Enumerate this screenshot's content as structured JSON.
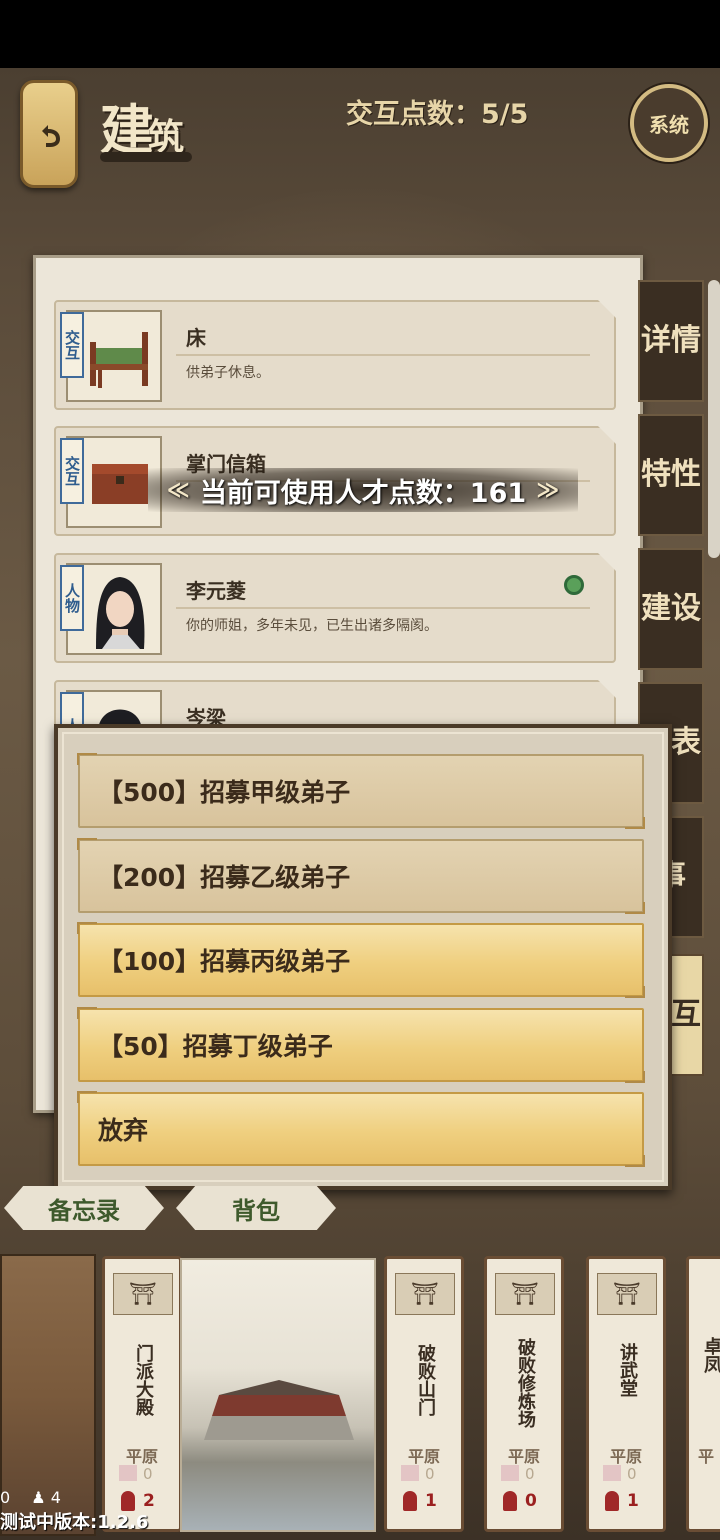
{
  "header": {
    "title_main": "建",
    "title_sub": "筑",
    "interaction_points_label": "交互点数：5/5",
    "system_button": "系统"
  },
  "side_tabs": [
    {
      "label": "详情",
      "active": false
    },
    {
      "label": "特性",
      "active": false
    },
    {
      "label": "建设",
      "active": false
    },
    {
      "label": "报表",
      "active": false
    },
    {
      "label": "事",
      "active": false
    },
    {
      "label": "交互",
      "active": true
    }
  ],
  "cards": [
    {
      "tag": "交互",
      "name": "床",
      "desc": "供弟子休息。",
      "icon": "bed-icon"
    },
    {
      "tag": "交互",
      "name": "掌门信箱",
      "desc": "",
      "icon": "chest-icon"
    },
    {
      "tag": "人物",
      "name": "李元菱",
      "desc": "你的师姐，多年未见，已生出诸多隔阂。",
      "icon": "portrait-icon"
    },
    {
      "tag": "人",
      "name": "岑梁",
      "desc": "",
      "icon": "portrait-icon"
    }
  ],
  "toast": {
    "text": "当前可使用人才点数：161"
  },
  "dialog": {
    "options": [
      {
        "label": "【500】招募甲级弟子",
        "enabled": false
      },
      {
        "label": "【200】招募乙级弟子",
        "enabled": false
      },
      {
        "label": "【100】招募丙级弟子",
        "enabled": true
      },
      {
        "label": "【50】招募丁级弟子",
        "enabled": true
      },
      {
        "label": "放弃",
        "enabled": true
      }
    ]
  },
  "bottom_tabs": {
    "memo": "备忘录",
    "bag": "背包"
  },
  "building_cards": [
    {
      "name": "门派大殿",
      "terrain": "平原",
      "count_a": "0",
      "count_b": "2"
    },
    {
      "name": "破败山门",
      "terrain": "平原",
      "count_a": "0",
      "count_b": "1"
    },
    {
      "name": "破败修炼场",
      "terrain": "平原",
      "count_a": "0",
      "count_b": "0"
    },
    {
      "name": "讲武堂",
      "terrain": "平原",
      "count_a": "0",
      "count_b": "1"
    },
    {
      "name": "卓凤",
      "terrain": "平",
      "count_a": "",
      "count_b": ""
    }
  ],
  "status": {
    "left_count": "0",
    "people_count": "4"
  },
  "version": "测试中版本:1.2.6"
}
